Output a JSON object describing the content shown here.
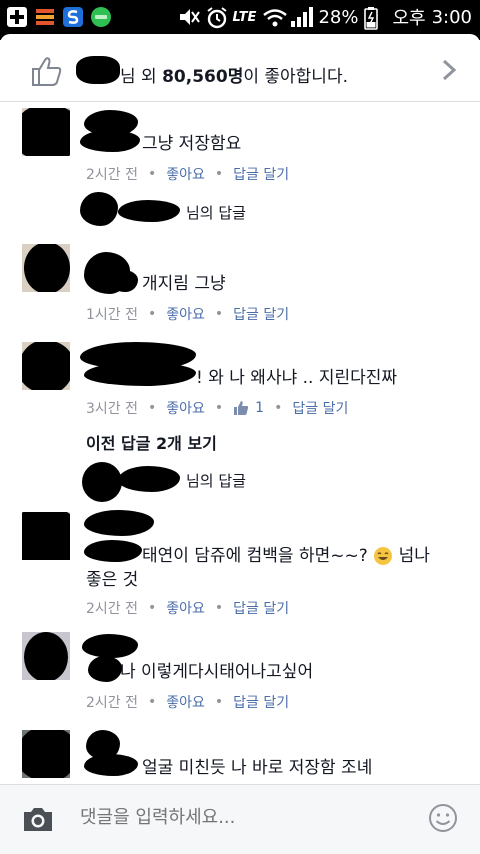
{
  "statusbar": {
    "signal_label": "LTE",
    "battery": "28%",
    "ampm": "오후",
    "time": "3:00"
  },
  "likes": {
    "suffix": "님 외 ",
    "count": "80,560명",
    "tail": "이 좋아합니다."
  },
  "comments": [
    {
      "text": "그냥 저장함요",
      "time": "2시간 전",
      "like": "좋아요",
      "reply": "답글 달기"
    },
    {
      "reply_to": "님의 답글"
    },
    {
      "text": "개지림 그냥",
      "time": "1시간 전",
      "like": "좋아요",
      "reply": "답글 달기"
    },
    {
      "text": "!  와 나 왜사냐 .. 지린다진짜",
      "time": "3시간 전",
      "like": "좋아요",
      "like_count": "1",
      "reply": "답글 달기"
    },
    {
      "more": "이전 답글 2개 보기"
    },
    {
      "reply_to": "님의 답글"
    },
    {
      "text_line1": "태연이 담쥬에 컴백을 하면~~?",
      "text_line1_end": "넘나",
      "text_line2": "좋은 것",
      "time": "2시간 전",
      "like": "좋아요",
      "reply": "답글 달기"
    },
    {
      "text": "나 이렇게다시태어나고싶어",
      "time": "2시간 전",
      "like": "좋아요",
      "reply": "답글 달기"
    },
    {
      "text": "얼굴 미친듯 나 바로 저장함 조녜"
    }
  ],
  "composer": {
    "placeholder": "댓글을 입력하세요..."
  },
  "icons": {
    "status_left": [
      "plus-icon",
      "stack-icon",
      "s-app-icon",
      "green-circle-icon"
    ],
    "status_right": [
      "mute-icon",
      "alarm-icon",
      "wifi-icon",
      "signal-icon",
      "battery-icon"
    ],
    "header": [
      "thumbs-up-icon",
      "chevron-right-icon"
    ],
    "composer": [
      "camera-icon",
      "smiley-icon"
    ]
  },
  "colors": {
    "link": "#4b6ea9",
    "meta": "#90949c",
    "text": "#141823"
  }
}
